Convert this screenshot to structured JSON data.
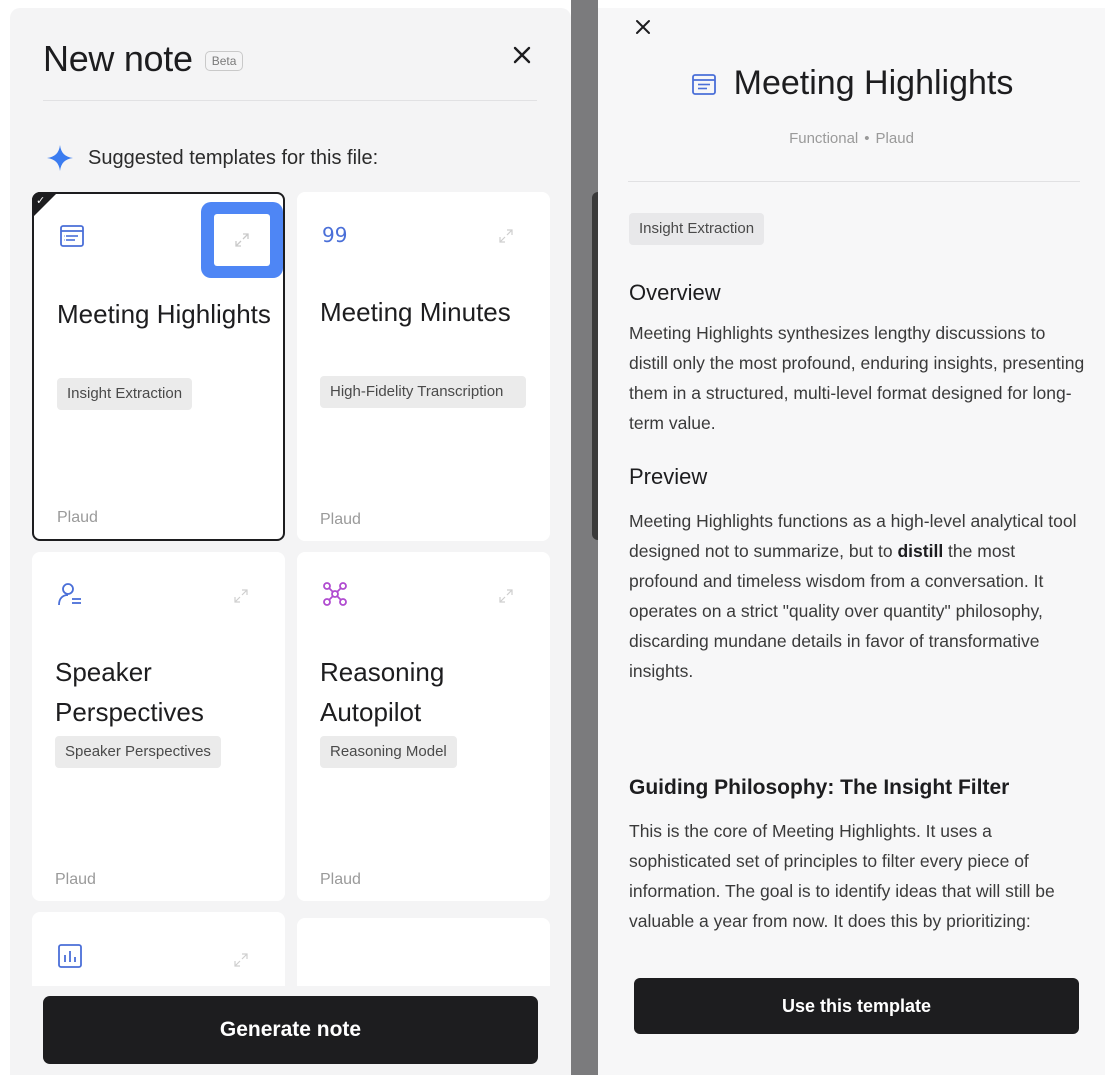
{
  "left": {
    "title": "New note",
    "beta": "Beta",
    "suggest_label": "Suggested templates for this file:",
    "cards": [
      {
        "name": "Meeting Highlights",
        "tag": "Insight Extraction",
        "author": "Plaud",
        "icon": "document-list-icon",
        "selected": true
      },
      {
        "name": "Meeting Minutes",
        "tag": "High-Fidelity Transcription",
        "author": "Plaud",
        "icon": "quote-99-icon"
      },
      {
        "name": "Speaker Perspectives",
        "tag": "Speaker Perspectives",
        "author": "Plaud",
        "icon": "person-list-icon"
      },
      {
        "name": "Reasoning Autopilot",
        "tag": "Reasoning Model",
        "author": "Plaud",
        "icon": "network-nodes-icon"
      },
      {
        "name": "",
        "tag": "",
        "author": "",
        "icon": "bar-chart-icon"
      },
      {
        "name": "",
        "tag": "",
        "author": "",
        "icon": ""
      }
    ],
    "generate_label": "Generate note"
  },
  "right": {
    "title": "Meeting Highlights",
    "meta_category": "Functional",
    "meta_author": "Plaud",
    "tag": "Insight Extraction",
    "overview_heading": "Overview",
    "overview_text": "Meeting Highlights synthesizes lengthy discussions to distill only the most profound, enduring insights, presenting them in a structured, multi-level format designed for long-term value.",
    "preview_heading": "Preview",
    "preview_text_before": "Meeting Highlights functions as a high-level analytical tool designed not to summarize, but to ",
    "preview_text_bold": "distill",
    "preview_text_after": " the most profound and timeless wisdom from a conversation. It operates on a strict \"quality over quantity\" philosophy, discarding mundane details in favor of transformative insights.",
    "philosophy_heading": "Guiding Philosophy: The Insight Filter",
    "philosophy_text": "This is the core of Meeting Highlights. It uses a sophisticated set of principles to filter every piece of information. The goal is to identify ideas that will still be valuable a year from now. It does this by prioritizing:",
    "use_label": "Use this template"
  },
  "colors": {
    "accent_blue": "#4e86f5",
    "icon_blue": "#4a6fd8",
    "icon_purple": "#b04bd0",
    "dark": "#1d1d1f"
  }
}
